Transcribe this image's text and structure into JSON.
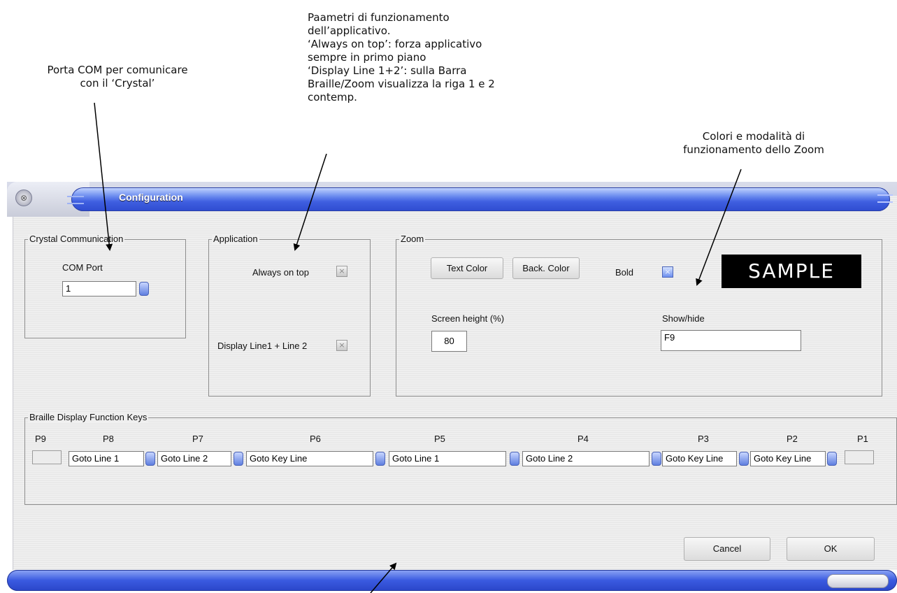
{
  "callouts": {
    "com": "Porta COM per comunicare\ncon il ‘Crystal’",
    "application": "Paametri di funzionamento\ndell’applicativo.\n‘Always on top’: forza applicativo\nsempre in primo piano\n‘Display Line 1+2’: sulla Barra\nBraille/Zoom visualizza la riga 1 e 2\ncontemp.",
    "zoom": "Colori e modalità di\nfunzionamento dello Zoom"
  },
  "window": {
    "title": "Configuration",
    "close_glyph": "⊗"
  },
  "crystal": {
    "legend": "Crystal Communication",
    "com_label": "COM Port",
    "com_value": "1"
  },
  "application": {
    "legend": "Application",
    "always_on_top": "Always on top",
    "display_lines": "Display Line1 + Line 2",
    "always_on_top_checked": false,
    "display_lines_checked": false
  },
  "zoom": {
    "legend": "Zoom",
    "text_color_btn": "Text Color",
    "back_color_btn": "Back. Color",
    "bold_label": "Bold",
    "bold_checked": true,
    "sample_text": "SAMPLE",
    "screen_height_label": "Screen height (%)",
    "screen_height_value": "80",
    "show_hide_label": "Show/hide",
    "show_hide_value": "F9"
  },
  "function_keys": {
    "legend": "Braille Display Function Keys",
    "headers": [
      "P9",
      "P8",
      "P7",
      "P6",
      "P5",
      "P4",
      "P3",
      "P2",
      "P1"
    ],
    "values": [
      "",
      "Goto Line 1",
      "Goto Line 2",
      "Goto Key Line",
      "Goto Line 1",
      "Goto Line 2",
      "Goto Key Line",
      "Goto Key Line",
      ""
    ]
  },
  "buttons": {
    "cancel": "Cancel",
    "ok": "OK"
  },
  "colors": {
    "titlebar": "#3f5fe0",
    "sample_bg": "#000000",
    "sample_fg": "#ffffff"
  }
}
